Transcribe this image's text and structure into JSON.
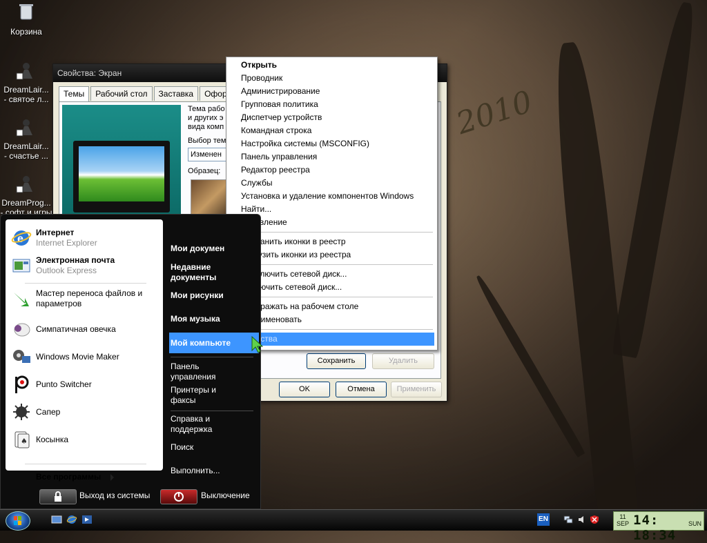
{
  "desktop": {
    "icons": [
      {
        "label": "Корзина"
      },
      {
        "label_line1": "DreamLair...",
        "label_line2": "- святое л..."
      },
      {
        "label_line1": "DreamLair...",
        "label_line2": "- счастье ..."
      },
      {
        "label_line1": "DreamProg...",
        "label_line2": "- софт и игры"
      }
    ],
    "wallpaper_text": "2010"
  },
  "dialog": {
    "title": "Свойства: Экран",
    "tabs": [
      "Темы",
      "Рабочий стол",
      "Заставка",
      "Оформлен"
    ],
    "active_tab": "Темы",
    "description": "Тема рабо и других э вида комп",
    "theme_label": "Выбор тем",
    "theme_value": "Изменен",
    "sample_label": "Образец:",
    "save_button": "Сохранить",
    "delete_button": "Удалить",
    "ok_button": "OK",
    "cancel_button": "Отмена",
    "apply_button": "Применить"
  },
  "context_menu": {
    "items": [
      {
        "label": "Открыть",
        "bold": true
      },
      {
        "label": "Проводник"
      },
      {
        "label": "Администрирование"
      },
      {
        "label": "Групповая политика"
      },
      {
        "label": "Диспетчер устройств"
      },
      {
        "label": "Командная строка"
      },
      {
        "label": "Настройка системы (MSCONFIG)"
      },
      {
        "label": "Панель управления"
      },
      {
        "label": "Редактор реестра"
      },
      {
        "label": "Службы"
      },
      {
        "label": "Установка и удаление компонентов Windows"
      },
      {
        "label": "Найти..."
      },
      {
        "label": "Управление"
      },
      {
        "label": "Сохранить иконки в реестр"
      },
      {
        "label": "Загрузить иконки из реестра"
      },
      {
        "label": "Подключить сетевой диск..."
      },
      {
        "label": "Отключить сетевой диск..."
      },
      {
        "label": "Отображать на рабочем столе"
      },
      {
        "label": "Переименовать"
      },
      {
        "label": "Свойства",
        "highlighted": true
      }
    ]
  },
  "start_menu": {
    "pinned": [
      {
        "title": "Интернет",
        "subtitle": "Internet Explorer",
        "icon": "internet-explorer-icon"
      },
      {
        "title": "Электронная почта",
        "subtitle": "Outlook Express",
        "icon": "outlook-express-icon"
      }
    ],
    "recent": [
      {
        "title_line1": "Мастер переноса файлов и",
        "title_line2": "параметров",
        "icon": "transfer-wizard-icon"
      },
      {
        "title": "Симпатичная овечка",
        "icon": "sheep-icon"
      },
      {
        "title": "Windows Movie Maker",
        "icon": "movie-maker-icon"
      },
      {
        "title": "Punto Switcher",
        "icon": "punto-switcher-icon"
      },
      {
        "title": "Сапер",
        "icon": "minesweeper-icon"
      },
      {
        "title": "Косынка",
        "icon": "solitaire-icon"
      }
    ],
    "all_programs": "Все программы",
    "right": {
      "my_documents": "Мои докумен",
      "recent_docs_line1": "Недавние",
      "recent_docs_line2": "документы",
      "my_pictures": "Мои рисунки",
      "my_music": "Моя музыка",
      "my_computer": "Мой компьюте",
      "control_panel_line1": "Панель",
      "control_panel_line2": "управления",
      "printers_line1": "Принтеры и",
      "printers_line2": "факсы",
      "help_line1": "Справка и",
      "help_line2": "поддержка",
      "search": "Поиск",
      "run": "Выполнить..."
    },
    "logoff": "Выход из системы",
    "shutdown": "Выключение"
  },
  "taskbar": {
    "language": "EN",
    "clock": {
      "day": "11",
      "month": "SEP",
      "time": "14: 18:34",
      "weekday": "SUN"
    }
  }
}
